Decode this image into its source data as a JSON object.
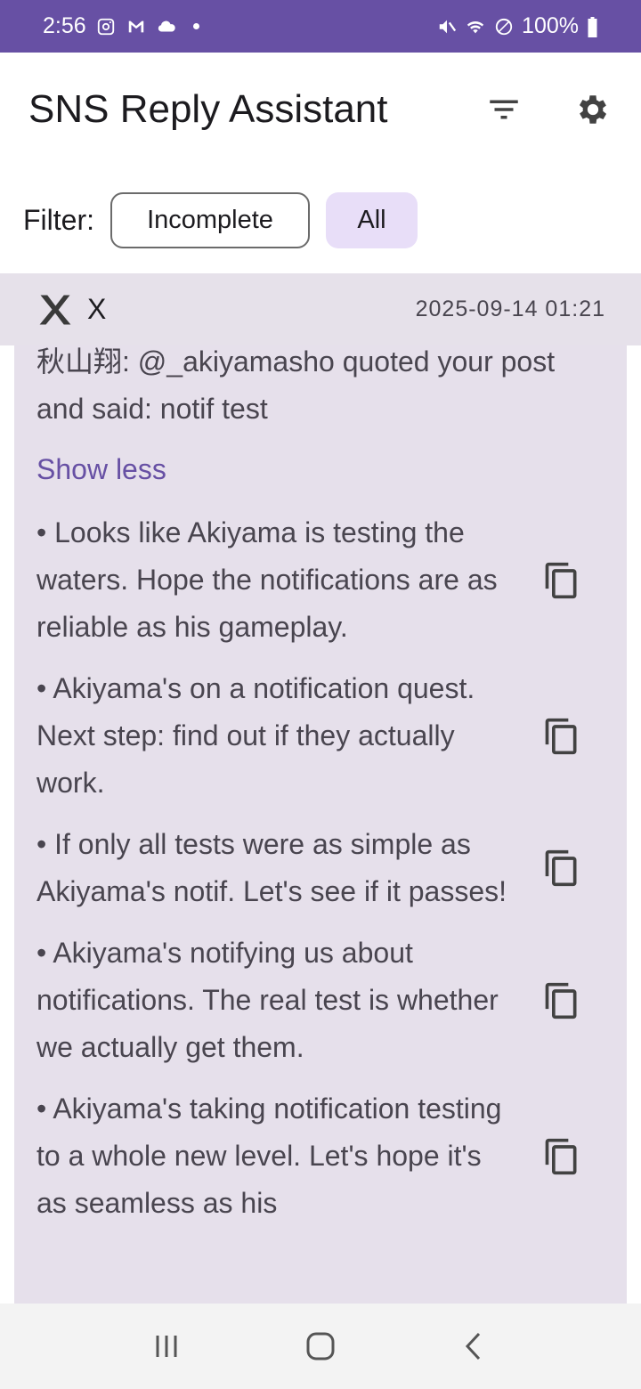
{
  "status_bar": {
    "time": "2:56",
    "battery": "100%",
    "left_icons": [
      "instagram-icon",
      "gmail-icon",
      "cloud-icon",
      "dot-icon"
    ],
    "right_icons": [
      "mute-icon",
      "wifi-icon",
      "no-disturb-icon",
      "battery-icon"
    ]
  },
  "app_bar": {
    "title": "SNS Reply Assistant",
    "actions": [
      "filter-icon",
      "gear-icon"
    ]
  },
  "filter": {
    "label": "Filter:",
    "options": [
      "Incomplete",
      "All"
    ],
    "selected": "All"
  },
  "card": {
    "sns_name": "X",
    "sns_icon": "x-logo-icon",
    "timestamp": "2025-09-14 01:21",
    "message": "秋山翔: @_akiyamasho quoted your post and said: notif test",
    "toggle_label": "Show less",
    "replies": [
      "• Looks like Akiyama is testing the waters. Hope the notifications are as reliable as his gameplay.",
      "• Akiyama's on a notification quest. Next step: find out if they actually work.",
      "• If only all tests were as simple as Akiyama's notif. Let's see if it passes!",
      "• Akiyama's notifying us about notifications. The real test is whether we actually get them.",
      "• Akiyama's taking notification testing to a whole new level. Let's hope it's as seamless as his"
    ]
  },
  "nav_bar": {
    "buttons": [
      "recent-apps-icon",
      "home-icon",
      "back-icon"
    ]
  },
  "colors": {
    "primary": "#6750a4",
    "chip_selected": "#e8def8",
    "card_bg": "#e6e0eb"
  }
}
